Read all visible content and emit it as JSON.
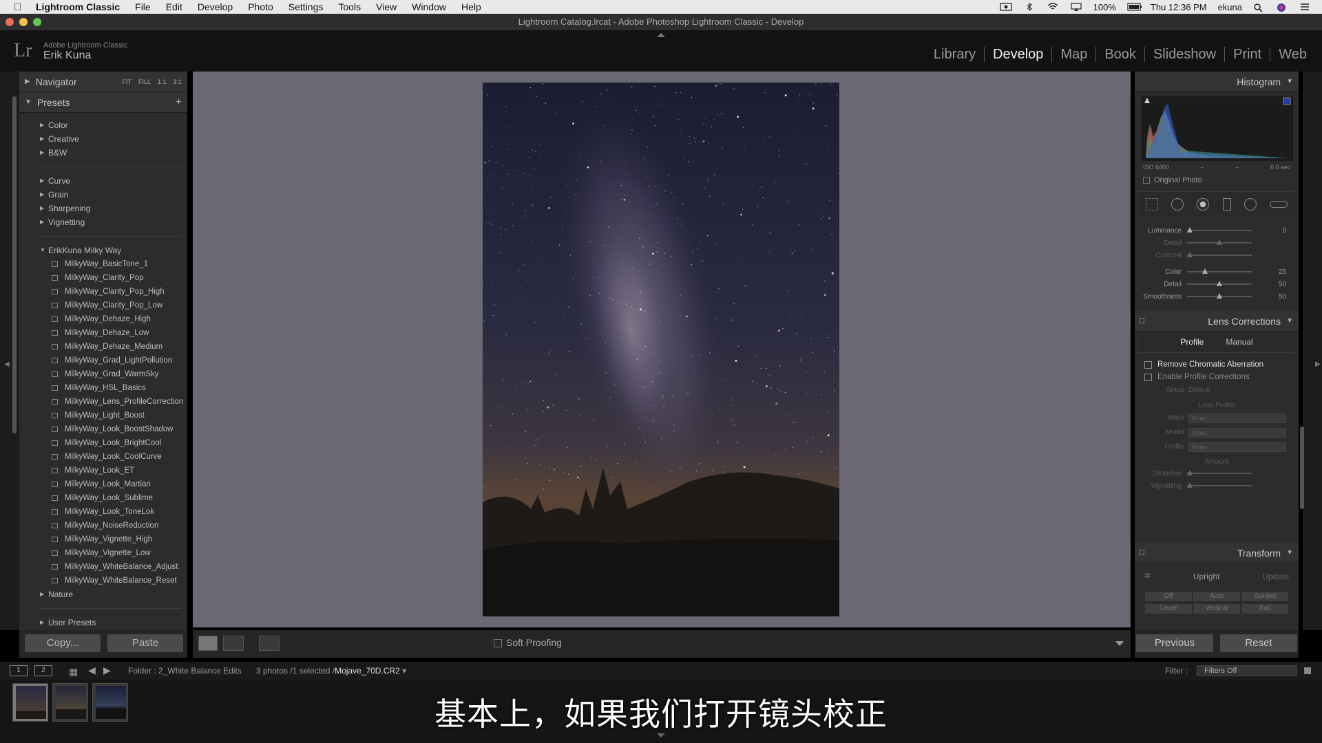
{
  "menubar": {
    "app": "Lightroom Classic",
    "items": [
      "File",
      "Edit",
      "Develop",
      "Photo",
      "Settings",
      "Tools",
      "View",
      "Window",
      "Help"
    ],
    "battery": "100%",
    "clock": "Thu 12:36 PM",
    "user": "ekuna"
  },
  "window": {
    "title": "Lightroom Catalog.lrcat - Adobe Photoshop Lightroom Classic - Develop"
  },
  "identity": {
    "logo": "Lr",
    "product": "Adobe Lightroom Classic",
    "user": "Erik Kuna"
  },
  "modules": {
    "items": [
      "Library",
      "Develop",
      "Map",
      "Book",
      "Slideshow",
      "Print",
      "Web"
    ],
    "active": "Develop"
  },
  "left_panel": {
    "navigator": {
      "title": "Navigator",
      "zoom": [
        "FIT",
        "FILL",
        "1:1",
        "3:1"
      ]
    },
    "presets": {
      "title": "Presets",
      "groups_a": [
        "Color",
        "Creative",
        "B&W"
      ],
      "groups_b": [
        "Curve",
        "Grain",
        "Sharpening",
        "Vignetting"
      ],
      "open_group": "ErikKuna Milky Way",
      "items": [
        "MilkyWay_BasicTone_1",
        "MilkyWay_Clarity_Pop",
        "MilkyWay_Clarity_Pop_High",
        "MilkyWay_Clarity_Pop_Low",
        "MilkyWay_Dehaze_High",
        "MilkyWay_Dehaze_Low",
        "MilkyWay_Dehaze_Medium",
        "MilkyWay_Grad_LightPollution",
        "MilkyWay_Grad_WarmSky",
        "MilkyWay_HSL_Basics",
        "MilkyWay_Lens_ProfileCorrection",
        "MilkyWay_Light_Boost",
        "MilkyWay_Look_BoostShadow",
        "MilkyWay_Look_BrightCool",
        "MilkyWay_Look_CoolCurve",
        "MilkyWay_Look_ET",
        "MilkyWay_Look_Martian",
        "MilkyWay_Look_Sublime",
        "MilkyWay_Look_ToneLok",
        "MilkyWay_NoiseReduction",
        "MilkyWay_Vignette_High",
        "MilkyWay_Vignette_Low",
        "MilkyWay_WhiteBalance_Adjust",
        "MilkyWay_WhiteBalance_Reset"
      ],
      "after_group": "Nature",
      "user_presets": "User Presets"
    },
    "copy_label": "Copy...",
    "paste_label": "Paste"
  },
  "toolbar": {
    "soft_proofing": "Soft Proofing"
  },
  "right_panel": {
    "histogram": {
      "title": "Histogram",
      "iso": "ISO 6400",
      "dash1": "–",
      "dash2": "–",
      "shutter": "6.0 sec",
      "original_photo": "Original Photo"
    },
    "noise": {
      "rows": [
        {
          "label": "Luminance",
          "value": "0",
          "level": 0.0,
          "dim": false
        },
        {
          "label": "Detail",
          "value": "",
          "level": 0.5,
          "dim": true
        },
        {
          "label": "Contrast",
          "value": "",
          "level": 0.0,
          "dim": true
        },
        {
          "label": "Color",
          "value": "25",
          "level": 0.25,
          "dim": false
        },
        {
          "label": "Detail",
          "value": "50",
          "level": 0.5,
          "dim": false
        },
        {
          "label": "Smoothness",
          "value": "50",
          "level": 0.5,
          "dim": false
        }
      ]
    },
    "lens_corrections": {
      "title": "Lens Corrections",
      "tabs": [
        "Profile",
        "Manual"
      ],
      "remove_ca": "Remove Chromatic Aberration",
      "enable_profile": "Enable Profile Corrections",
      "setup_label": "Setup",
      "setup_value": "Default",
      "lens_profile": "Lens Profile",
      "make_label": "Make",
      "make_value": "None",
      "model_label": "Model",
      "model_value": "None",
      "profile_label": "Profile",
      "profile_value": "None",
      "amount": "Amount",
      "distortion": "Distortion",
      "vignetting": "Vignetting"
    },
    "transform": {
      "title": "Transform",
      "upright": "Upright",
      "update": "Update",
      "row1": [
        "Off",
        "Auto",
        "Guided"
      ],
      "row2": [
        "Level",
        "Vertical",
        "Full"
      ]
    },
    "previous_label": "Previous",
    "reset_label": "Reset"
  },
  "filmstrip": {
    "monitor1": "1",
    "monitor2": "2",
    "folder": "Folder : 2_White Balance Edits",
    "count": "3 photos /1 selected /",
    "filename": "Mojave_70D.CR2",
    "filter_label": "Filter :",
    "filter_value": "Filters Off"
  },
  "subtitle": "基本上，如果我们打开镜头校正"
}
